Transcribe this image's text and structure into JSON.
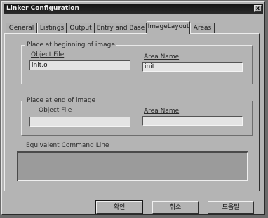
{
  "window": {
    "title": "Linker Configuration",
    "close_glyph": "x"
  },
  "tabs": [
    {
      "label": "General"
    },
    {
      "label": "Listings"
    },
    {
      "label": "Output"
    },
    {
      "label": "Entry and Base"
    },
    {
      "label": "ImageLayout",
      "active": true
    },
    {
      "label": "Areas"
    }
  ],
  "beginning_group": {
    "title": "Place at beginning of image",
    "object_file_label": "Object File",
    "object_file_value": "init.o",
    "area_name_label": "Area Name",
    "area_name_value": "init"
  },
  "end_group": {
    "title": "Place at end of image",
    "object_file_label": "Object File",
    "object_file_value": "",
    "area_name_label": "Area Name",
    "area_name_value": ""
  },
  "command_line": {
    "title": "Equivalent Command Line",
    "value": ""
  },
  "buttons": {
    "ok": "확인",
    "cancel": "취소",
    "help": "도움말"
  }
}
